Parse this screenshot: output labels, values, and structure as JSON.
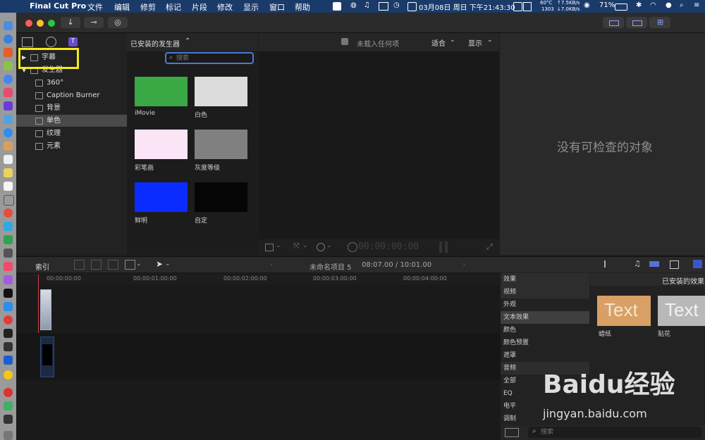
{
  "menubar": {
    "app": "Final Cut Pro",
    "items": [
      "文件",
      "编辑",
      "修剪",
      "标记",
      "片段",
      "修改",
      "显示",
      "窗口",
      "帮助"
    ],
    "temp": "60°C",
    "fan": "1303",
    "net_up": "↑7.5KB/s",
    "net_down": "↓7.0KB/s",
    "datetime": "03月08日 周日 下午21:43:30",
    "battery": "71%"
  },
  "toolbar": {
    "import_icon": "download-arrow-icon",
    "keywords_icon": "key-icon",
    "check_icon": "checkmark-icon"
  },
  "sidebar": {
    "items": [
      {
        "label": "字幕",
        "level": 0
      },
      {
        "label": "发生器",
        "level": 0
      },
      {
        "label": "360°",
        "level": 1
      },
      {
        "label": "Caption Burner",
        "level": 1
      },
      {
        "label": "背景",
        "level": 1
      },
      {
        "label": "单色",
        "level": 1,
        "selected": true
      },
      {
        "label": "纹理",
        "level": 1
      },
      {
        "label": "元素",
        "level": 1
      }
    ]
  },
  "browser": {
    "title": "已安装的发生器",
    "search_placeholder": "搜索",
    "thumbs": [
      {
        "label": "iMovie",
        "color": "#3aa844"
      },
      {
        "label": "白色",
        "color": "#dcdcdc"
      },
      {
        "label": "彩笔画",
        "color": "#fbe4f6"
      },
      {
        "label": "灰度等级",
        "color": "#808080"
      },
      {
        "label": "鲜明",
        "color": "#0a2cff"
      },
      {
        "label": "自定",
        "color": "#050505"
      }
    ]
  },
  "viewer": {
    "status": "未载入任何项",
    "fit": "适合",
    "display": "显示",
    "timecode": "00:00:00:00"
  },
  "inspector": {
    "empty": "没有可检查的对象"
  },
  "timeline": {
    "index": "索引",
    "project": "未命名项目 5",
    "duration": "08:07.00 / 10:01.00",
    "ruler": [
      "00:00:00:00",
      "00:00:01:00:00",
      "00:00:02:00:00",
      "00:00:03:00:00",
      "00:00:04:00:00"
    ]
  },
  "effects": {
    "header": "效果",
    "installed": "已安装的效果",
    "categories": [
      {
        "label": "视频",
        "type": "head"
      },
      {
        "label": "外观"
      },
      {
        "label": "文本效果",
        "selected": true
      },
      {
        "label": "颜色"
      },
      {
        "label": "颜色预置"
      },
      {
        "label": "遮罩"
      },
      {
        "label": "音频",
        "type": "head"
      },
      {
        "label": "全部"
      },
      {
        "label": "EQ"
      },
      {
        "label": "电平"
      },
      {
        "label": "调制"
      }
    ],
    "thumb_text": "Text",
    "thumbs": [
      {
        "label": "蜡纸"
      },
      {
        "label": "贴花"
      }
    ],
    "search_placeholder": "搜索"
  },
  "watermark": {
    "logo": "Baidu经验",
    "url": "jingyan.baidu.com"
  },
  "colors": {
    "highlight": "#f3ec18",
    "accent": "#3a5fd8"
  }
}
